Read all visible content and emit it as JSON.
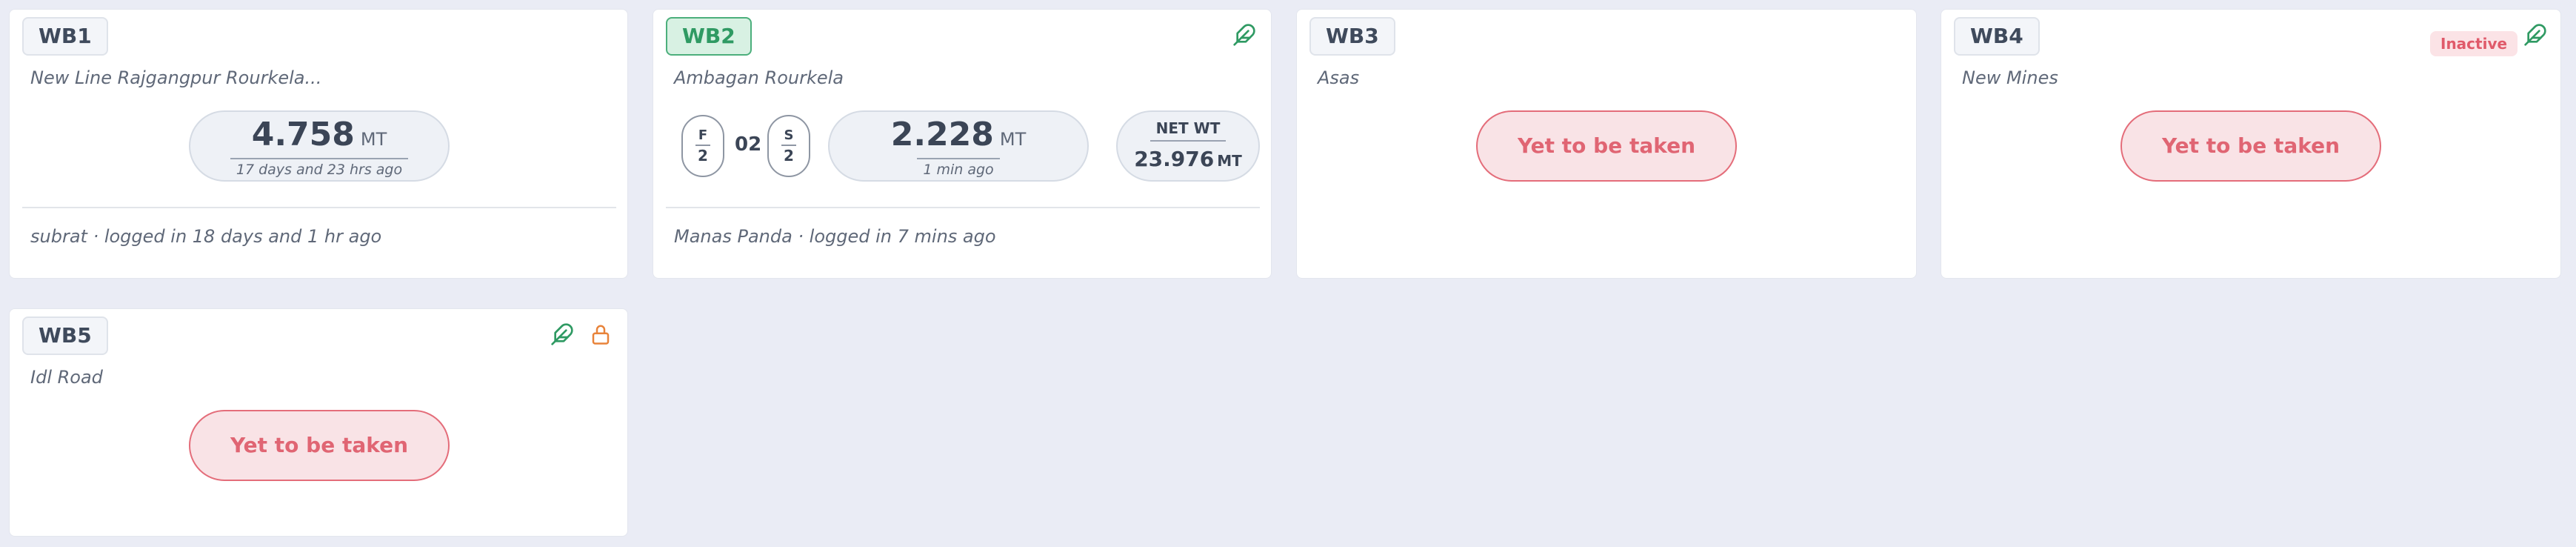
{
  "colors": {
    "background": "#eaecf5",
    "card": "#ffffff",
    "active_green": "#2f9a63",
    "warning_red": "#e06573",
    "lock_orange": "#e8833a"
  },
  "cards": [
    {
      "id": "WB1",
      "location": "New Line Rajgangpur Rourkela...",
      "weight": {
        "value": "4.758",
        "unit": "MT",
        "ago": "17 days and 23 hrs ago"
      },
      "footer": "subrat · logged in 18 days and 1 hr ago"
    },
    {
      "id": "WB2",
      "active": true,
      "icon": "feather-icon",
      "location": "Ambagan Rourkela",
      "ratio": {
        "f_label": "F",
        "f_value": "2",
        "middle": "02",
        "s_label": "S",
        "s_value": "2"
      },
      "weight": {
        "value": "2.228",
        "unit": "MT",
        "ago": "1 min ago"
      },
      "net_wt": {
        "label": "NET WT",
        "value": "23.976",
        "unit": "MT"
      },
      "footer": "Manas Panda · logged in 7 mins ago"
    },
    {
      "id": "WB3",
      "location": "Asas",
      "status_button": "Yet to be taken"
    },
    {
      "id": "WB4",
      "location": "New Mines",
      "badge": "Inactive",
      "icon": "feather-icon",
      "status_button": "Yet to be taken"
    },
    {
      "id": "WB5",
      "location": "Idl Road",
      "icons": [
        "feather-icon",
        "unlock-icon"
      ],
      "status_button": "Yet to be taken"
    }
  ]
}
